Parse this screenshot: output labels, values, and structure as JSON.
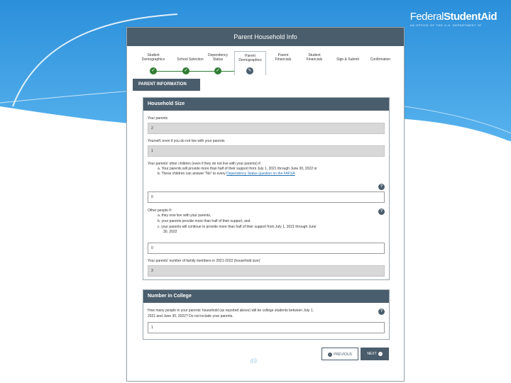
{
  "brand": {
    "name_thin": "Federal",
    "name_bold": "StudentAid",
    "tagline": "AN OFFICE OF THE U.S. DEPARTMENT OF EDUCATION"
  },
  "window_title": "Parent Household Info",
  "steps": [
    {
      "label": "Student Demographics",
      "state": "complete"
    },
    {
      "label": "School Selection",
      "state": "complete"
    },
    {
      "label": "Dependency Status",
      "state": "complete"
    },
    {
      "label": "Parent Demographics",
      "state": "active"
    },
    {
      "label": "Parent Financials",
      "state": "pending"
    },
    {
      "label": "Student Financials",
      "state": "pending"
    },
    {
      "label": "Sign & Submit",
      "state": "pending"
    },
    {
      "label": "Confirmation",
      "state": "pending"
    }
  ],
  "section_tab": "PARENT INFORMATION",
  "household": {
    "title": "Household Size",
    "parents_label": "Your parents",
    "parents_value": "2",
    "yourself_label": "Yourself, even if you do not live with your parents",
    "yourself_value": "1",
    "other_children_label": "Your parents' other children (even if they do not live with your parents) if:",
    "other_children_a": "a. Your parents will provide more than half of their support from July 1, 2021 through June 30, 2022 or",
    "other_children_b_pre": "b. These children can answer \"No\" to every ",
    "other_children_b_link": "Dependency Status question on the FAFSA",
    "other_children_value": "0",
    "other_people_label": "Other people if:",
    "other_people_a": "a. they now live with your parents,",
    "other_people_b": "b. your parents provide more than half of their support, and",
    "other_people_c": "c. your parents will continue to provide more than half of their support from July 1, 2021 through June",
    "other_people_c2": "30, 2022",
    "other_people_value": "0",
    "family_label": "Your parents' number of family members in 2021-2022 (household size)",
    "family_value": "3"
  },
  "college": {
    "title": "Number in College",
    "question_1": "How many people in your parents' household (as reported above) will be college students between July 1,",
    "question_2": "2021 and June 30, 2022? Do not include your parents.",
    "value": "1"
  },
  "help_glyph": "?",
  "buttons": {
    "previous": "PREVIOUS",
    "next": "NEXT"
  },
  "slide_number": "49",
  "colors": {
    "header": "#4a5d6c",
    "complete": "#2f7d32",
    "slide_blue": "#2a8fd8"
  }
}
